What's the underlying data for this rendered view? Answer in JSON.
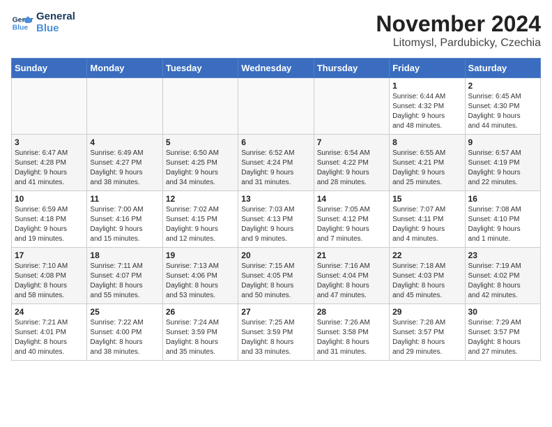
{
  "header": {
    "logo_line1": "General",
    "logo_line2": "Blue",
    "month": "November 2024",
    "location": "Litomysl, Pardubicky, Czechia"
  },
  "days_of_week": [
    "Sunday",
    "Monday",
    "Tuesday",
    "Wednesday",
    "Thursday",
    "Friday",
    "Saturday"
  ],
  "weeks": [
    [
      {
        "day": "",
        "info": ""
      },
      {
        "day": "",
        "info": ""
      },
      {
        "day": "",
        "info": ""
      },
      {
        "day": "",
        "info": ""
      },
      {
        "day": "",
        "info": ""
      },
      {
        "day": "1",
        "info": "Sunrise: 6:44 AM\nSunset: 4:32 PM\nDaylight: 9 hours\nand 48 minutes."
      },
      {
        "day": "2",
        "info": "Sunrise: 6:45 AM\nSunset: 4:30 PM\nDaylight: 9 hours\nand 44 minutes."
      }
    ],
    [
      {
        "day": "3",
        "info": "Sunrise: 6:47 AM\nSunset: 4:28 PM\nDaylight: 9 hours\nand 41 minutes."
      },
      {
        "day": "4",
        "info": "Sunrise: 6:49 AM\nSunset: 4:27 PM\nDaylight: 9 hours\nand 38 minutes."
      },
      {
        "day": "5",
        "info": "Sunrise: 6:50 AM\nSunset: 4:25 PM\nDaylight: 9 hours\nand 34 minutes."
      },
      {
        "day": "6",
        "info": "Sunrise: 6:52 AM\nSunset: 4:24 PM\nDaylight: 9 hours\nand 31 minutes."
      },
      {
        "day": "7",
        "info": "Sunrise: 6:54 AM\nSunset: 4:22 PM\nDaylight: 9 hours\nand 28 minutes."
      },
      {
        "day": "8",
        "info": "Sunrise: 6:55 AM\nSunset: 4:21 PM\nDaylight: 9 hours\nand 25 minutes."
      },
      {
        "day": "9",
        "info": "Sunrise: 6:57 AM\nSunset: 4:19 PM\nDaylight: 9 hours\nand 22 minutes."
      }
    ],
    [
      {
        "day": "10",
        "info": "Sunrise: 6:59 AM\nSunset: 4:18 PM\nDaylight: 9 hours\nand 19 minutes."
      },
      {
        "day": "11",
        "info": "Sunrise: 7:00 AM\nSunset: 4:16 PM\nDaylight: 9 hours\nand 15 minutes."
      },
      {
        "day": "12",
        "info": "Sunrise: 7:02 AM\nSunset: 4:15 PM\nDaylight: 9 hours\nand 12 minutes."
      },
      {
        "day": "13",
        "info": "Sunrise: 7:03 AM\nSunset: 4:13 PM\nDaylight: 9 hours\nand 9 minutes."
      },
      {
        "day": "14",
        "info": "Sunrise: 7:05 AM\nSunset: 4:12 PM\nDaylight: 9 hours\nand 7 minutes."
      },
      {
        "day": "15",
        "info": "Sunrise: 7:07 AM\nSunset: 4:11 PM\nDaylight: 9 hours\nand 4 minutes."
      },
      {
        "day": "16",
        "info": "Sunrise: 7:08 AM\nSunset: 4:10 PM\nDaylight: 9 hours\nand 1 minute."
      }
    ],
    [
      {
        "day": "17",
        "info": "Sunrise: 7:10 AM\nSunset: 4:08 PM\nDaylight: 8 hours\nand 58 minutes."
      },
      {
        "day": "18",
        "info": "Sunrise: 7:11 AM\nSunset: 4:07 PM\nDaylight: 8 hours\nand 55 minutes."
      },
      {
        "day": "19",
        "info": "Sunrise: 7:13 AM\nSunset: 4:06 PM\nDaylight: 8 hours\nand 53 minutes."
      },
      {
        "day": "20",
        "info": "Sunrise: 7:15 AM\nSunset: 4:05 PM\nDaylight: 8 hours\nand 50 minutes."
      },
      {
        "day": "21",
        "info": "Sunrise: 7:16 AM\nSunset: 4:04 PM\nDaylight: 8 hours\nand 47 minutes."
      },
      {
        "day": "22",
        "info": "Sunrise: 7:18 AM\nSunset: 4:03 PM\nDaylight: 8 hours\nand 45 minutes."
      },
      {
        "day": "23",
        "info": "Sunrise: 7:19 AM\nSunset: 4:02 PM\nDaylight: 8 hours\nand 42 minutes."
      }
    ],
    [
      {
        "day": "24",
        "info": "Sunrise: 7:21 AM\nSunset: 4:01 PM\nDaylight: 8 hours\nand 40 minutes."
      },
      {
        "day": "25",
        "info": "Sunrise: 7:22 AM\nSunset: 4:00 PM\nDaylight: 8 hours\nand 38 minutes."
      },
      {
        "day": "26",
        "info": "Sunrise: 7:24 AM\nSunset: 3:59 PM\nDaylight: 8 hours\nand 35 minutes."
      },
      {
        "day": "27",
        "info": "Sunrise: 7:25 AM\nSunset: 3:59 PM\nDaylight: 8 hours\nand 33 minutes."
      },
      {
        "day": "28",
        "info": "Sunrise: 7:26 AM\nSunset: 3:58 PM\nDaylight: 8 hours\nand 31 minutes."
      },
      {
        "day": "29",
        "info": "Sunrise: 7:28 AM\nSunset: 3:57 PM\nDaylight: 8 hours\nand 29 minutes."
      },
      {
        "day": "30",
        "info": "Sunrise: 7:29 AM\nSunset: 3:57 PM\nDaylight: 8 hours\nand 27 minutes."
      }
    ]
  ]
}
